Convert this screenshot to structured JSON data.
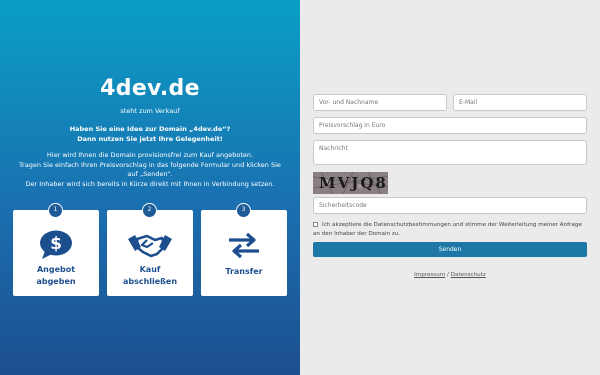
{
  "hero": {
    "domain": "4dev.de",
    "subtitle": "steht zum Verkauf",
    "question_line1": "Haben Sie eine Idee zur Domain „4dev.de“?",
    "question_line2": "Dann nutzen Sie jetzt Ihre Gelegenheit!",
    "desc_line1": "Hier wird Ihnen die Domain provisionsfrei zum Kauf angeboten.",
    "desc_line2": "Tragen Sie einfach Ihren Preisvorschlag in das folgende Formular und klicken Sie",
    "desc_line3": "auf „Senden“.",
    "desc_line4": "Der Inhaber wird sich bereits in Kürze direkt mit Ihnen in Verbindung setzen."
  },
  "steps": [
    {
      "num": "1",
      "label1": "Angebot",
      "label2": "abgeben",
      "icon": "money-bubble-icon"
    },
    {
      "num": "2",
      "label1": "Kauf",
      "label2": "abschließen",
      "icon": "handshake-icon"
    },
    {
      "num": "3",
      "label1": "Transfer",
      "label2": "",
      "icon": "transfer-arrows-icon"
    }
  ],
  "form": {
    "name_placeholder": "Vor- und Nachname",
    "email_placeholder": "E-Mail",
    "price_placeholder": "Preisvorschlag in Euro",
    "message_placeholder": "Nachricht",
    "captcha_text": "MVJQ8",
    "security_placeholder": "Sicherheitscode",
    "consent_text": "Ich akzeptiere die Datenschutzbestimmungen und stimme der Weiterleitung meiner Anfrage an den Inhaber der Domain zu.",
    "submit_label": "Senden"
  },
  "footer": {
    "imprint": "Impressum",
    "separator": "/",
    "privacy": "Datenschutz"
  },
  "colors": {
    "gradient_top": "#0a9fc5",
    "gradient_bottom": "#1d4f8f",
    "button": "#1d78a8"
  }
}
